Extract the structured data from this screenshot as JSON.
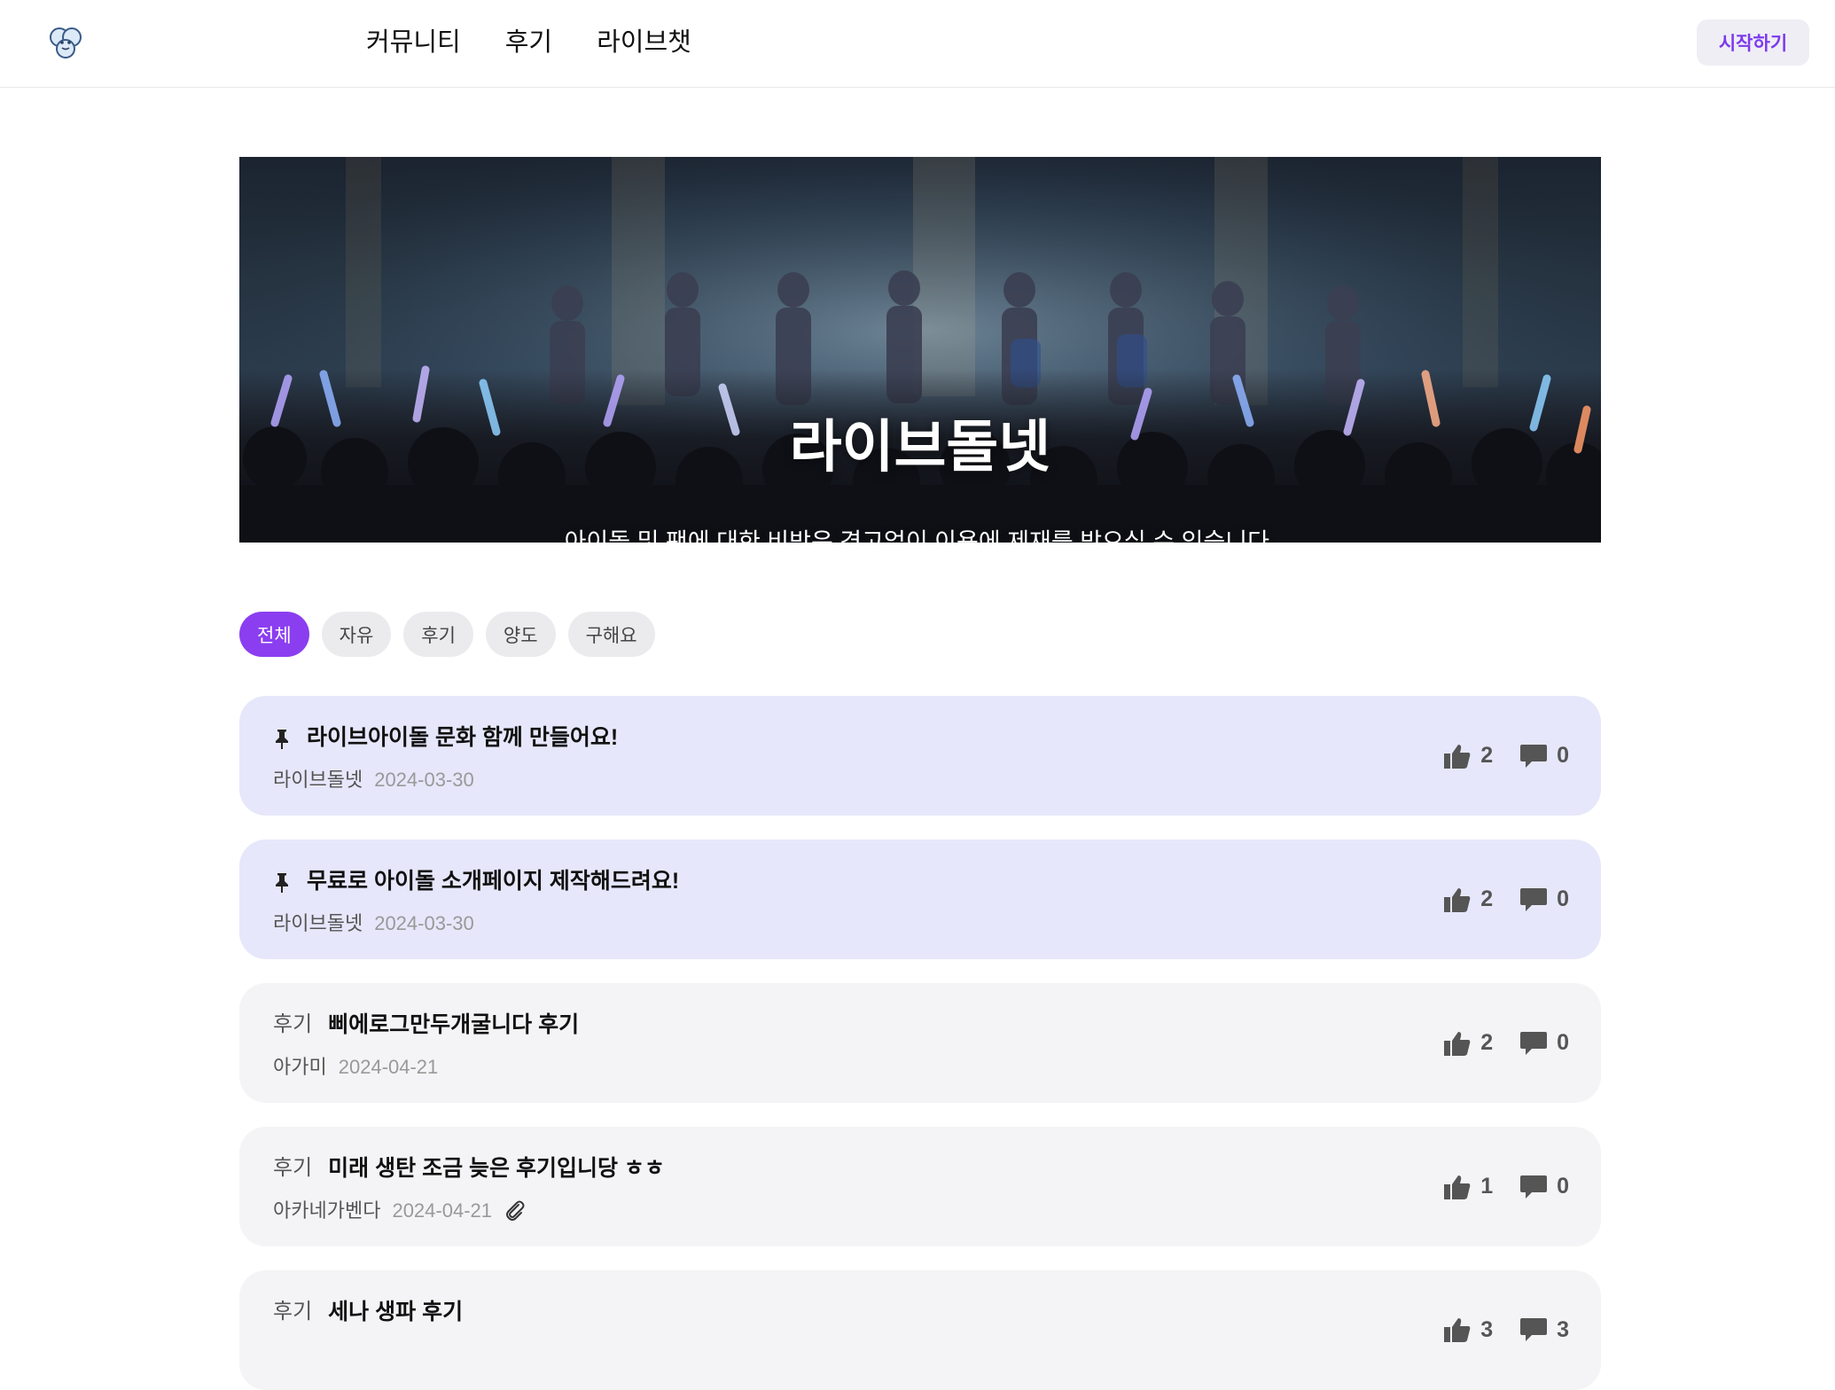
{
  "header": {
    "nav": [
      "커뮤니티",
      "후기",
      "라이브챗"
    ],
    "start_label": "시작하기"
  },
  "hero": {
    "title": "라이브돌넷",
    "subtitle": "아이돌 및 팬에 대한 비방은 경고없이 이용에 제재를 받으실 수 있습니다."
  },
  "filters": {
    "items": [
      "전체",
      "자유",
      "후기",
      "양도",
      "구해요"
    ],
    "active": "전체"
  },
  "posts": [
    {
      "pinned": true,
      "category": "",
      "title": "라이브아이돌 문화 함께 만들어요!",
      "author": "라이브돌넷",
      "date": "2024-03-30",
      "likes": "2",
      "comments": "0",
      "attachment": false
    },
    {
      "pinned": true,
      "category": "",
      "title": "무료로 아이돌 소개페이지 제작해드려요!",
      "author": "라이브돌넷",
      "date": "2024-03-30",
      "likes": "2",
      "comments": "0",
      "attachment": false
    },
    {
      "pinned": false,
      "category": "후기",
      "title": "삐에로그만두개굴니다 후기",
      "author": "아가미",
      "date": "2024-04-21",
      "likes": "2",
      "comments": "0",
      "attachment": false
    },
    {
      "pinned": false,
      "category": "후기",
      "title": "미래 생탄 조금 늦은 후기입니당 ㅎㅎ",
      "author": "아카네가벤다",
      "date": "2024-04-21",
      "likes": "1",
      "comments": "0",
      "attachment": true
    },
    {
      "pinned": false,
      "category": "후기",
      "title": "세나 생파 후기",
      "author": "",
      "date": "",
      "likes": "3",
      "comments": "3",
      "attachment": false
    }
  ],
  "icons": {
    "pin": "pin-icon",
    "like": "thumbs-up-icon",
    "comment": "comment-icon",
    "attachment": "paperclip-icon"
  },
  "colors": {
    "accent": "#8b3ef0",
    "pinned_bg": "#e6e7fa",
    "post_bg": "#f4f4f6"
  }
}
